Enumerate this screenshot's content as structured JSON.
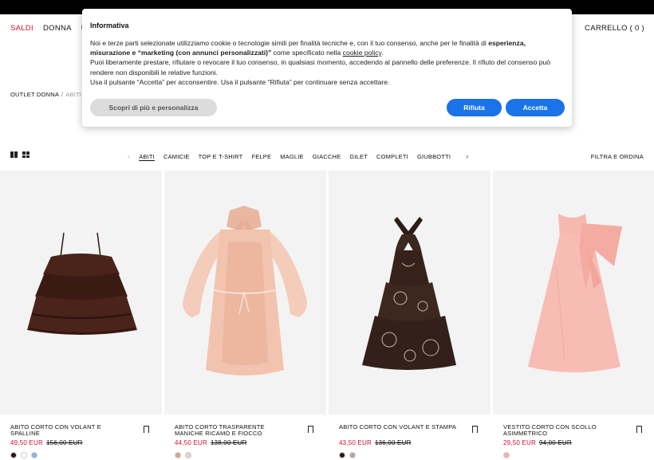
{
  "nav": {
    "left": [
      "SALDI",
      "DONNA",
      "U"
    ],
    "right": [
      "NT",
      "CARRELLO ( 0 )"
    ]
  },
  "breadcrumb": {
    "first": "OUTLET DONNA",
    "separator": "/",
    "current": "ABITI"
  },
  "toolbar": {
    "categories": [
      "ABITI",
      "CAMICIE",
      "TOP E T-SHIRT",
      "FELPE",
      "MAGLIE",
      "GIACCHE",
      "GILET",
      "COMPLETI",
      "GIUBBOTTI"
    ],
    "filter_label": "FILTRA E ORDINA"
  },
  "products": [
    {
      "name": "ABITO CORTO CON VOLANT E SPALLINE",
      "price": "49,50 EUR",
      "old_price": "156,00 EUR",
      "swatches": [
        "#2a1612",
        "#ffffff",
        "#8fb0e8"
      ]
    },
    {
      "name": "ABITO CORTO TRASPARENTE MANICHE RICAMO E FIOCCO",
      "price": "44,50 EUR",
      "old_price": "138,00 EUR",
      "swatches": [
        "#d6a48f",
        "#e3d5c4"
      ]
    },
    {
      "name": "ABITO CORTO CON VOLANT E STAMPA",
      "price": "43,50 EUR",
      "old_price": "136,00 EUR",
      "swatches": [
        "#2a1a14",
        "#bca694"
      ]
    },
    {
      "name": "VESTITO CORTO CON SCOLLO ASIMMETRICO",
      "price": "29,50 EUR",
      "old_price": "94,00 EUR",
      "swatches": [
        "#f0b3ae"
      ]
    }
  ],
  "cookie": {
    "title": "Informativa",
    "p1_a": "Noi e terze parti selezionate utilizziamo cookie o tecnologie simili per finalità tecniche e, con il tuo consenso, anche per le finalità di ",
    "p1_b": "esperienza, misurazione e “marketing (con annunci personalizzati)”",
    "p1_c": " come specificato nella ",
    "p1_link": "cookie policy",
    "p1_d": ".",
    "p2": "Puoi liberamente prestare, rifiutare o revocare il tuo consenso, in qualsiasi momento, accedendo al pannello delle preferenze. Il rifiuto del consenso può rendere non disponibili le relative funzioni.",
    "p3": "Usa il pulsante “Accetta” per acconsentire. Usa il pulsante “Rifiuta” per continuare senza accettare.",
    "btn_more": "Scopri di più e personalizza",
    "btn_reject": "Rifiuta",
    "btn_accept": "Accetta"
  },
  "colors": {
    "sale": "#d0112b",
    "button_blue": "#1a73e8"
  }
}
